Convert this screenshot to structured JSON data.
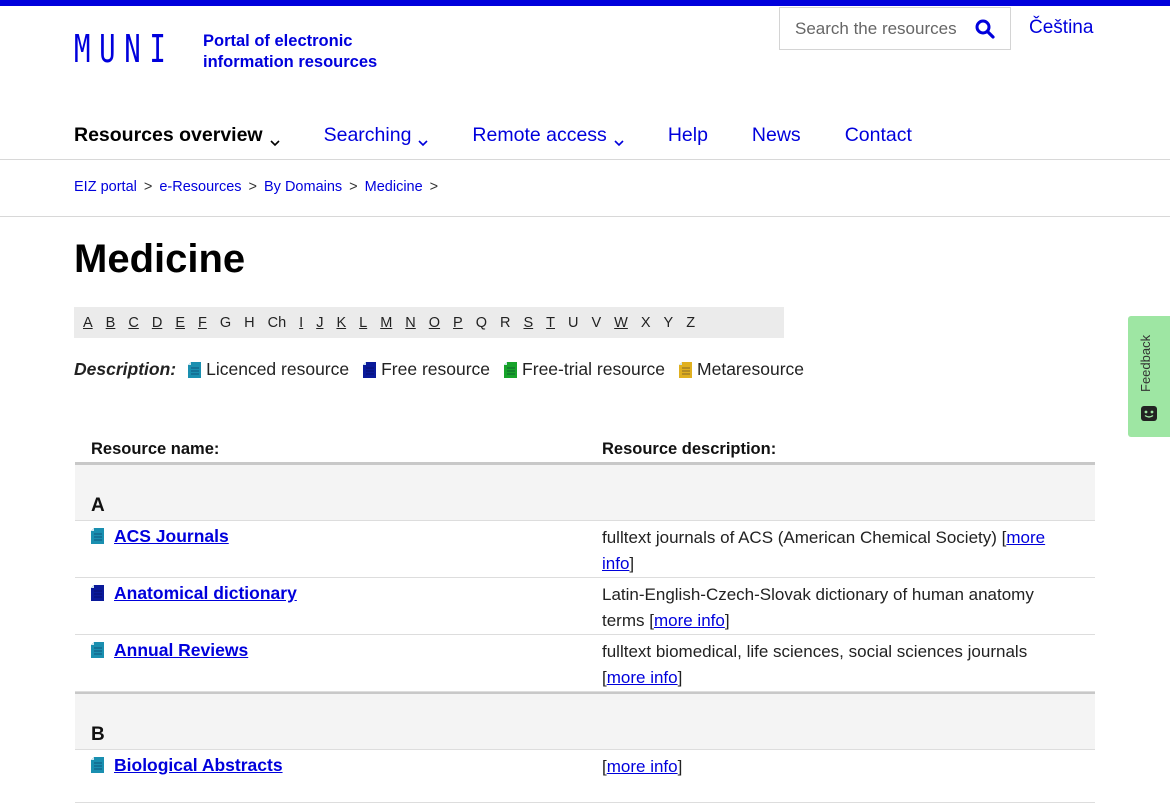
{
  "header": {
    "logo_mark": "MUNI",
    "logo_line1": "Portal of electronic",
    "logo_line2": "information resources",
    "search_placeholder": "Search the resources",
    "language": "Čeština"
  },
  "nav": [
    {
      "label": "Resources overview",
      "dropdown": true
    },
    {
      "label": "Searching",
      "dropdown": true
    },
    {
      "label": "Remote access",
      "dropdown": true
    },
    {
      "label": "Help",
      "dropdown": false
    },
    {
      "label": "News",
      "dropdown": false
    },
    {
      "label": "Contact",
      "dropdown": false
    }
  ],
  "breadcrumb": [
    "EIZ portal",
    "e-Resources",
    "By Domains",
    "Medicine"
  ],
  "breadcrumb_sep": ">",
  "page_title": "Medicine",
  "alphabet": [
    "A",
    "B",
    "C",
    "D",
    "E",
    "F",
    "G",
    "H",
    "Ch",
    "I",
    "J",
    "K",
    "L",
    "M",
    "N",
    "O",
    "P",
    "Q",
    "R",
    "S",
    "T",
    "U",
    "V",
    "W",
    "X",
    "Y",
    "Z"
  ],
  "alphabet_links": [
    "A",
    "B",
    "C",
    "D",
    "E",
    "F",
    "I",
    "J",
    "K",
    "L",
    "M",
    "N",
    "O",
    "P",
    "S",
    "T",
    "W"
  ],
  "legend": {
    "label": "Description:",
    "items": [
      {
        "label": "Licenced resource",
        "icon": "licenced-icon",
        "color": "#1a8fb0"
      },
      {
        "label": "Free resource",
        "icon": "free-icon",
        "color": "#0a1a9a"
      },
      {
        "label": "Free-trial resource",
        "icon": "free-trial-icon",
        "color": "#17a32a"
      },
      {
        "label": "Metaresource",
        "icon": "metaresource-icon",
        "color": "#e0b020"
      }
    ]
  },
  "table": {
    "col1": "Resource name:",
    "col2": "Resource description:",
    "groups": [
      {
        "letter": "A",
        "rows": [
          {
            "name": "ACS Journals",
            "type": "licenced",
            "desc": "fulltext journals of ACS (American Chemical Society) ",
            "more": "more info"
          },
          {
            "name": "Anatomical dictionary",
            "type": "free",
            "desc": "Latin-English-Czech-Slovak dictionary of human anatomy terms ",
            "more": "more info"
          },
          {
            "name": "Annual Reviews",
            "type": "licenced",
            "desc": "fulltext biomedical, life sciences, social sciences journals ",
            "more": "more info"
          }
        ]
      },
      {
        "letter": "B",
        "rows": [
          {
            "name": "Biological Abstracts",
            "type": "licenced",
            "desc": "",
            "more": "more info"
          }
        ]
      }
    ]
  },
  "feedback_label": "Feedback",
  "colors": {
    "brand": "#0000dc",
    "feedback_bg": "#9ee6a3"
  }
}
